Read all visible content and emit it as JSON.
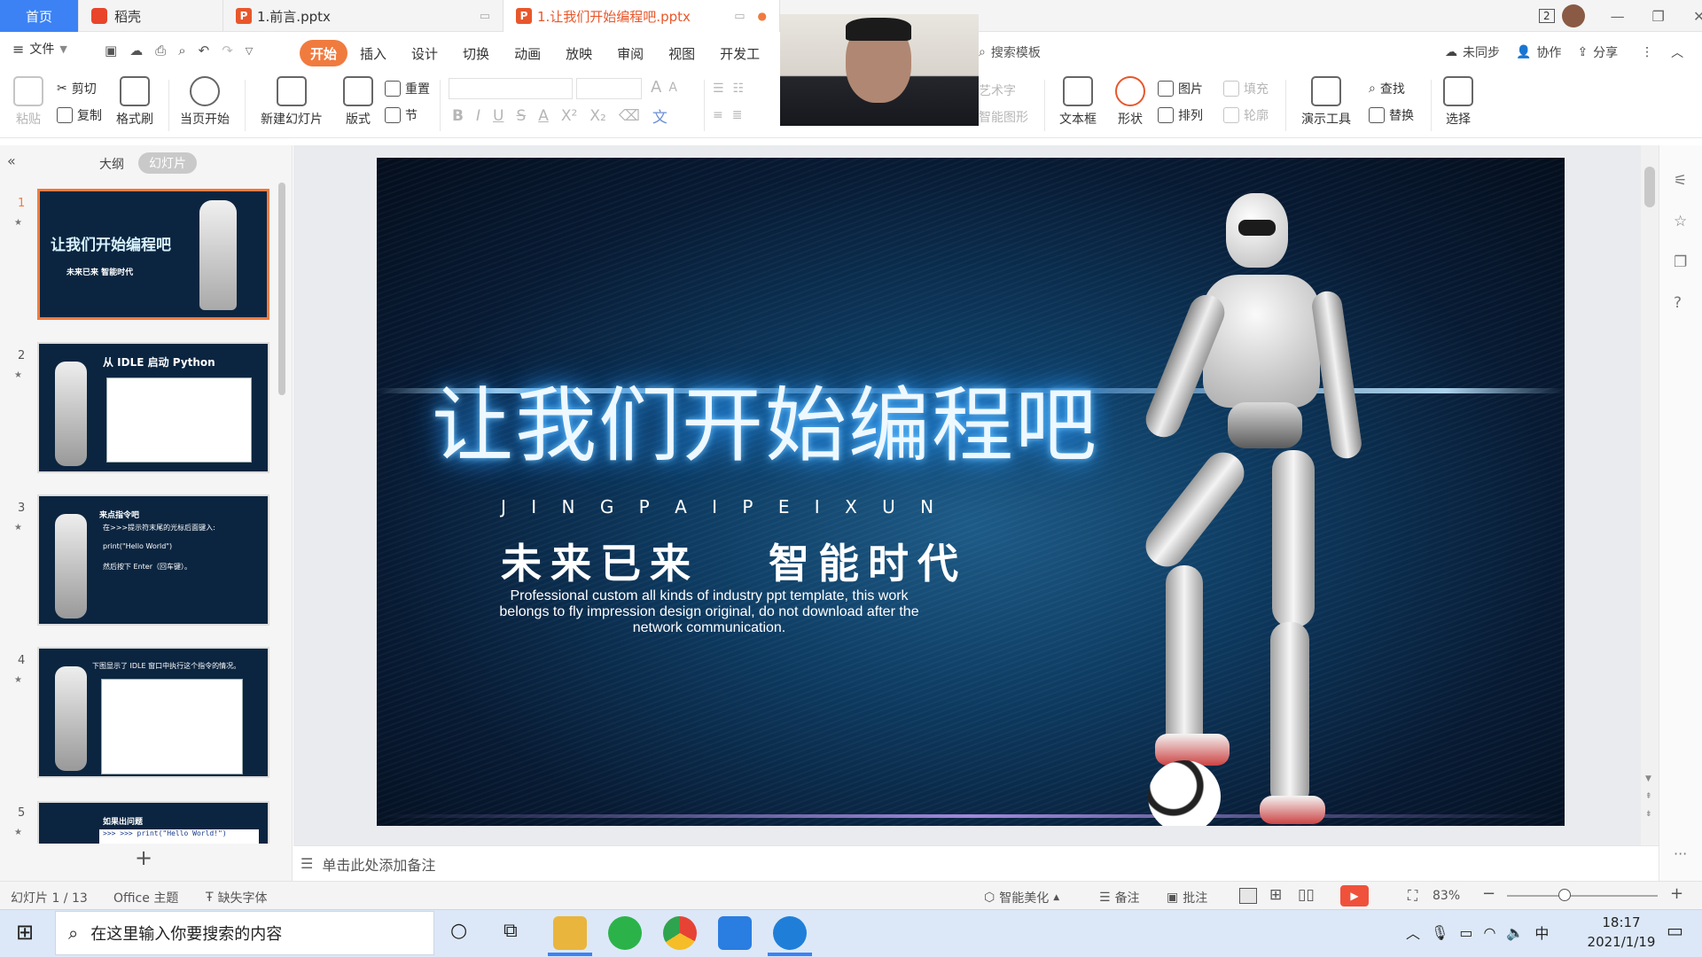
{
  "tabs": {
    "home": "首页",
    "daoke": "稻壳",
    "file1": "1.前言.pptx",
    "file2": "1.让我们开始编程吧.pptx",
    "badge": "P"
  },
  "titlebar": {
    "user_count": "2"
  },
  "menu": {
    "file": "文件",
    "items": [
      "开始",
      "插入",
      "设计",
      "切换",
      "动画",
      "放映",
      "审阅",
      "视图",
      "开发工"
    ],
    "search": "搜索模板",
    "unsynced": "未同步",
    "collab": "协作",
    "share": "分享"
  },
  "ribbon": {
    "paste": "粘贴",
    "cut": "剪切",
    "copy": "复制",
    "format_painter": "格式刷",
    "from_current": "当页开始",
    "new_slide": "新建幻灯片",
    "layout": "版式",
    "reset": "重置",
    "section": "节",
    "text_box": "文本框",
    "shape": "形状",
    "picture": "图片",
    "arrange": "排列",
    "fill": "填充",
    "outline": "轮廓",
    "art_text": "艺术字",
    "smart_shape": "智能图形",
    "presentation_tools": "演示工具",
    "find": "查找",
    "replace": "替换",
    "select": "选择",
    "bold": "B",
    "italic": "I",
    "underline": "U",
    "strike": "S",
    "font_color": "A",
    "superscript": "X²",
    "subscript": "X₂",
    "grow": "A",
    "shrink": "A"
  },
  "panel": {
    "outline_tab": "大纲",
    "slides_tab": "幻灯片",
    "add": "+"
  },
  "thumbs": [
    {
      "num": "1",
      "title": "让我们开始编程吧",
      "sub": "未来已来  智能时代"
    },
    {
      "num": "2",
      "title": "从 IDLE 启动 Python"
    },
    {
      "num": "3",
      "title": "来点指令吧",
      "lines": [
        "在>>>提示符末尾的光标后面键入:",
        "print(\"Hello World\")",
        "然后按下 Enter（回车键）。"
      ]
    },
    {
      "num": "4",
      "title": "下图显示了 IDLE 窗口中执行这个指令的情况。"
    },
    {
      "num": "5",
      "title": "如果出问题",
      "code": ">>> >>> print(\"Hello World!\")"
    }
  ],
  "slide": {
    "title": "让我们开始编程吧",
    "pinyin": "J I N G P A I P E I X U N",
    "subtitle": "未来已来   智能时代",
    "desc": [
      "Professional custom all kinds of industry ppt template, this work",
      "belongs to fly impression design original, do not download after the",
      "network communication."
    ]
  },
  "notes": {
    "placeholder": "单击此处添加备注"
  },
  "status": {
    "slide_count": "幻灯片 1 / 13",
    "theme": "Office 主题",
    "missing_font": "缺失字体",
    "beautify": "智能美化",
    "notes": "备注",
    "comment": "批注",
    "zoom": "83%"
  },
  "taskbar": {
    "search": "在这里输入你要搜索的内容",
    "time": "18:17",
    "date": "2021/1/19",
    "ime": "中"
  },
  "colors": {
    "accent": "#f07b3f",
    "home_tab": "#3c82f5"
  }
}
